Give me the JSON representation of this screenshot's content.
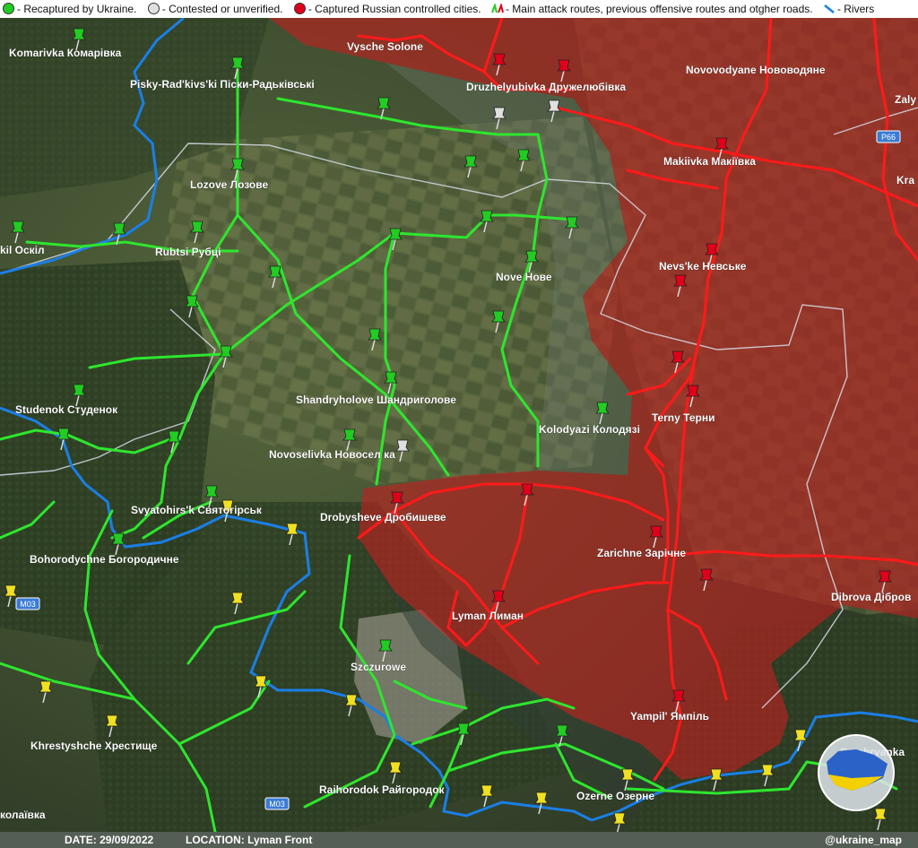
{
  "legend": {
    "recaptured": "- Recaptured by Ukraine.",
    "contested": "- Contested or unverified.",
    "captured": "- Captured Russian controlled cities.",
    "routes": "- Main attack routes, previous offensive routes and otgher roads.",
    "rivers": "- Rivers",
    "colors": {
      "green": "#22cc22",
      "white": "#e0e0e0",
      "red": "#e0001a",
      "blue": "#1a7fe6"
    }
  },
  "road_labels": {
    "p66": "P66",
    "m03_west": "M03",
    "m03_south": "M03"
  },
  "cities": {
    "komarivka": "Komarivka Комарівка",
    "pisky": "Pisky-Rad'kivs'ki Піски-Радьківські",
    "vysche_solone": "Vysche Solone",
    "druzhelyubivka": "Druzhelyubivka Дружелюбівка",
    "novovodyane": "Novovodyane Нововодяне",
    "zaly": "Zaly",
    "makiivka": "Makiivka Макіївка",
    "kra": "Kra",
    "lozove": "Lozove Лозове",
    "oskil": "kil Оскіл",
    "rubtsi": "Rubtsi Рубці",
    "nove": "Nove Нове",
    "nevske": "Nevs'ke Невське",
    "studenok": "Studenok Студенок",
    "shandryholove": "Shandryholove Шандриголове",
    "terny": "Terny Терни",
    "kolodyazi": "Kolodyazi Колодязі",
    "novoselivka": "Novoselivka Новосел   ка",
    "svyatohirsk": "Svyatohirs'k Святогірськ",
    "drobysheve": "Drobysheve Дробишеве",
    "bohorodychne": "Bohorodychne Богородичне",
    "zarichne": "Zarichne Зарічне",
    "dibrova": "Dibrova Дібров",
    "lyman": "Lyman Лиман",
    "szczurowe": "Szczurowe",
    "yampil": "Yampil' Ямпіль",
    "khrestyshche": "Khrestyshche Хрестище",
    "serebryanka": "Serebryanka",
    "raihorodok": "Raihorodok Райгородок",
    "ozerne": "Ozerne Озерне",
    "kolaivka": "колаївка"
  },
  "footer": {
    "date": "DATE: 29/09/2022",
    "location": "LOCATION: Lyman Front",
    "handle": "@ukraine_map"
  },
  "logo_icon": "ukraine-map-logo-icon"
}
